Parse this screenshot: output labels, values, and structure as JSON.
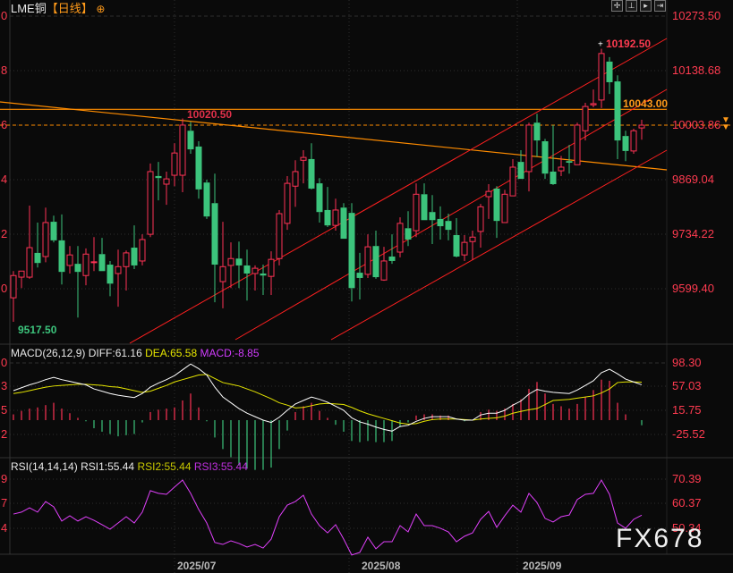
{
  "header": {
    "symbol": "LME铜",
    "period": "【日线】",
    "settings_icon": "crosshair-circle-icon",
    "toolbar_icons": [
      "crosshair-move-icon",
      "vertical-fit-icon",
      "play-forward-icon",
      "scroll-right-icon"
    ]
  },
  "price_axis": {
    "labels": [
      "10273.50",
      "10138.68",
      "10003.86",
      "9869.04",
      "9734.22",
      "9599.40"
    ],
    "left_labels": [
      "0",
      "8",
      "6",
      "4",
      "2",
      "0"
    ],
    "current_price": "10003.86"
  },
  "annotations": {
    "high_label": "10192.50",
    "prior_high_label": "10020.50",
    "level_label": "10043.00",
    "low_label": "9517.50"
  },
  "macd": {
    "params": "MACD(26,12,9)",
    "diff_label": "DIFF:61.16",
    "dea_label": "DEA:65.58",
    "macd_label": "MACD:-8.85",
    "axis_labels": [
      "98.30",
      "57.03",
      "15.75",
      "-25.52"
    ],
    "left_labels": [
      "0",
      "3",
      "5",
      "2"
    ]
  },
  "rsi": {
    "params": "RSI(14,14,14)",
    "rsi1_label": "RSI1:55.44",
    "rsi2_label": "RSI2:55.44",
    "rsi3_label": "RSI3:55.44",
    "axis_labels": [
      "70.39",
      "60.37",
      "50.34"
    ],
    "left_labels": [
      "9",
      "7",
      "4"
    ]
  },
  "dates": [
    "2025/07",
    "2025/08",
    "2025/09"
  ],
  "watermark": "FX678",
  "colors": {
    "up": "#ff3355",
    "down": "#3cc47c",
    "diff": "#ffffff",
    "dea": "#e6e600",
    "rsi": "#e040fb",
    "level": "#ff8c00",
    "channel": "#ff2020"
  },
  "chart_data": {
    "type": "candlestick",
    "ohlc_order": [
      "open",
      "high",
      "low",
      "close"
    ],
    "candles": [
      [
        9577,
        9643,
        9517.5,
        9632
      ],
      [
        9628,
        9643,
        9601,
        9643
      ],
      [
        9628,
        9805,
        9624,
        9701
      ],
      [
        9688,
        9763,
        9652,
        9663
      ],
      [
        9679,
        9800,
        9665,
        9763
      ],
      [
        9765,
        9780,
        9714,
        9719
      ],
      [
        9719,
        9783,
        9610,
        9641
      ],
      [
        9657,
        9705,
        9637,
        9683
      ],
      [
        9661,
        9705,
        9528,
        9641
      ],
      [
        9632,
        9699,
        9608,
        9685
      ],
      [
        9665,
        9727,
        9643,
        9666
      ],
      [
        9685,
        9725,
        9643,
        9643
      ],
      [
        9659,
        9668,
        9581,
        9612
      ],
      [
        9637,
        9696,
        9555,
        9654
      ],
      [
        9654,
        9694,
        9595,
        9688
      ],
      [
        9701,
        9756,
        9648,
        9657
      ],
      [
        9668,
        9734,
        9657,
        9721
      ],
      [
        9734,
        9909,
        9727,
        9889
      ],
      [
        9878,
        9913,
        9818,
        9873
      ],
      [
        9858,
        9889,
        9807,
        9871
      ],
      [
        9880,
        9959,
        9853,
        9935
      ],
      [
        9880,
        10020.5,
        9838,
        10004
      ],
      [
        9990,
        10012,
        9933,
        9944
      ],
      [
        9951,
        9964,
        9822,
        9845
      ],
      [
        9862,
        9869,
        9772,
        9778
      ],
      [
        9811,
        9884,
        9566,
        9659
      ],
      [
        9617,
        9765,
        9551,
        9654
      ],
      [
        9657,
        9714,
        9601,
        9674
      ],
      [
        9674,
        9716,
        9601,
        9657
      ],
      [
        9657,
        9696,
        9570,
        9637
      ],
      [
        9637,
        9657,
        9595,
        9650
      ],
      [
        9637,
        9659,
        9584,
        9632
      ],
      [
        9630,
        9692,
        9584,
        9672
      ],
      [
        9674,
        9794,
        9657,
        9785
      ],
      [
        9761,
        9878,
        9745,
        9860
      ],
      [
        9853,
        9917,
        9802,
        9889
      ],
      [
        9917,
        9942,
        9860,
        9924
      ],
      [
        9920,
        9959,
        9845,
        9847
      ],
      [
        9860,
        9873,
        9763,
        9789
      ],
      [
        9794,
        9851,
        9752,
        9756
      ],
      [
        9756,
        9822,
        9743,
        9794
      ],
      [
        9800,
        9811,
        9723,
        9723
      ],
      [
        9787,
        9811,
        9568,
        9601
      ],
      [
        9639,
        9688,
        9573,
        9626
      ],
      [
        9635,
        9734,
        9626,
        9703
      ],
      [
        9705,
        9743,
        9624,
        9628
      ],
      [
        9621,
        9703,
        9619,
        9668
      ],
      [
        9679,
        9734,
        9661,
        9668
      ],
      [
        9690,
        9776,
        9677,
        9761
      ],
      [
        9749,
        9791,
        9705,
        9721
      ],
      [
        9743,
        9860,
        9727,
        9833
      ],
      [
        9833,
        9860,
        9769,
        9769
      ],
      [
        9789,
        9831,
        9710,
        9769
      ],
      [
        9772,
        9803,
        9721,
        9754
      ],
      [
        9767,
        9785,
        9719,
        9745
      ],
      [
        9732,
        9774,
        9677,
        9679
      ],
      [
        9683,
        9732,
        9668,
        9714
      ],
      [
        9716,
        9743,
        9670,
        9727
      ],
      [
        9741,
        9809,
        9701,
        9802
      ],
      [
        9827,
        9858,
        9772,
        9840
      ],
      [
        9847,
        9853,
        9725,
        9767
      ],
      [
        9763,
        9844,
        9763,
        9833
      ],
      [
        9829,
        9920,
        9829,
        9900
      ],
      [
        9913,
        9942,
        9871,
        9871
      ],
      [
        9889,
        10010,
        9840,
        10004
      ],
      [
        10010,
        10032,
        9926,
        9966
      ],
      [
        9964,
        9970,
        9871,
        9884
      ],
      [
        9889,
        10004,
        9856,
        9858
      ],
      [
        9891,
        9928,
        9878,
        9900
      ],
      [
        9915,
        9955,
        9884,
        9911
      ],
      [
        9906,
        10010,
        9906,
        10004
      ],
      [
        9990,
        10059,
        9966,
        10050
      ],
      [
        10054,
        10092,
        10048,
        10057
      ],
      [
        10066,
        10192.5,
        10046,
        10181
      ],
      [
        10161,
        10172,
        10081,
        10110
      ],
      [
        10112,
        10127,
        9920,
        9966
      ],
      [
        9977,
        9990,
        9915,
        9940
      ],
      [
        9940,
        9995,
        9933,
        9990
      ],
      [
        9997,
        10017,
        9968,
        10003.86
      ]
    ],
    "price_range": [
      9490,
      10273.5
    ],
    "horizontal_levels": [
      10043.0,
      10003.86
    ],
    "macd": {
      "diff": [
        51,
        56,
        61,
        65,
        70,
        74,
        70,
        67,
        64,
        61,
        54,
        50,
        46,
        43,
        41,
        39,
        46,
        57,
        64,
        70,
        77,
        87,
        97,
        89,
        78,
        57,
        40,
        30,
        20,
        12,
        6,
        0,
        -4,
        5,
        17,
        28,
        34,
        40,
        36,
        31,
        24,
        17,
        4,
        -3,
        -7,
        -12,
        -16,
        -19,
        -11,
        -9,
        -2,
        3,
        6,
        6,
        6,
        2,
        0,
        0,
        9,
        12,
        12,
        17,
        26,
        33,
        45,
        53,
        50,
        48,
        47,
        46,
        52,
        60,
        68,
        82,
        88,
        80,
        71,
        66,
        61.16
      ],
      "dea": [
        46,
        48,
        51,
        54,
        57,
        59,
        60,
        61,
        62,
        62,
        61,
        60,
        58,
        57,
        54,
        51,
        48,
        50,
        55,
        60,
        66,
        70,
        74,
        78,
        79,
        72,
        65,
        62,
        59,
        54,
        49,
        43,
        37,
        30,
        26,
        21,
        22,
        25,
        28,
        29,
        28,
        27,
        22,
        16,
        11,
        7,
        3,
        -1,
        -5,
        -7,
        -6,
        -2,
        1,
        2,
        2,
        2,
        1,
        0,
        2,
        3,
        4,
        7,
        12,
        15,
        18,
        20,
        27,
        34,
        35,
        36,
        38,
        40,
        42,
        47,
        54,
        65,
        66,
        66,
        65.58
      ],
      "histogram": [
        10,
        16,
        20,
        22,
        26,
        30,
        20,
        12,
        4,
        -2,
        -14,
        -20,
        -24,
        -28,
        -26,
        -24,
        -4,
        14,
        18,
        20,
        22,
        34,
        46,
        22,
        -2,
        -30,
        -50,
        -64,
        -78,
        -84,
        -86,
        -86,
        -82,
        -50,
        -18,
        14,
        24,
        30,
        16,
        4,
        -8,
        -20,
        -36,
        -38,
        -36,
        -38,
        -38,
        -36,
        -12,
        -4,
        8,
        10,
        10,
        8,
        8,
        0,
        -2,
        0,
        14,
        18,
        16,
        20,
        28,
        36,
        54,
        66,
        46,
        28,
        24,
        20,
        28,
        40,
        52,
        70,
        68,
        30,
        10,
        0,
        -8.85
      ]
    },
    "rsi": [
      55.9,
      56.7,
      58.5,
      56.7,
      61.1,
      58.9,
      53.0,
      55.2,
      53.0,
      54.8,
      53.3,
      51.5,
      49.6,
      52.2,
      54.8,
      52.2,
      56.7,
      65.6,
      64.5,
      64.1,
      67.1,
      70.0,
      64.5,
      57.8,
      52.2,
      44.1,
      43.3,
      44.8,
      43.7,
      42.2,
      43.3,
      41.8,
      45.5,
      54.8,
      59.6,
      61.1,
      63.7,
      55.9,
      51.1,
      48.1,
      51.5,
      45.5,
      38.9,
      40.0,
      46.3,
      41.5,
      44.4,
      44.4,
      51.1,
      48.5,
      55.9,
      51.1,
      51.1,
      50.0,
      48.5,
      44.4,
      46.7,
      48.1,
      53.7,
      57.0,
      50.4,
      55.2,
      59.6,
      56.7,
      64.5,
      60.7,
      54.1,
      52.6,
      54.8,
      55.5,
      61.9,
      64.1,
      64.5,
      70.0,
      64.1,
      52.2,
      50.0,
      53.7,
      55.44
    ]
  }
}
